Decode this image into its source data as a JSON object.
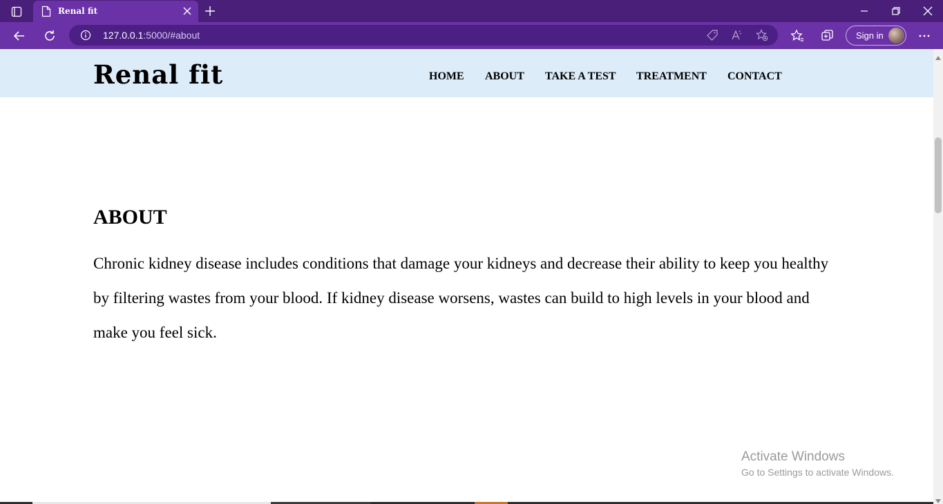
{
  "browser": {
    "tab_title": "Renal fit",
    "url_host": "127.0.0.1",
    "url_rest": ":5000/#about",
    "sign_in_label": "Sign in",
    "accent": "#6b32a8",
    "tabbar_color": "#4a1f7a"
  },
  "site": {
    "brand": "Renal fit",
    "nav": [
      "HOME",
      "ABOUT",
      "TAKE A TEST",
      "TREATMENT",
      "CONTACT"
    ],
    "header_color": "#dcecf9"
  },
  "about": {
    "heading": "ABOUT",
    "body": "Chronic kidney disease includes conditions that damage your kidneys and decrease their ability to keep you healthy by filtering wastes from your blood. If kidney disease worsens, wastes can build to high levels in your blood and make you feel sick."
  },
  "watermark": {
    "title": "Activate Windows",
    "subtitle": "Go to Settings to activate Windows."
  }
}
